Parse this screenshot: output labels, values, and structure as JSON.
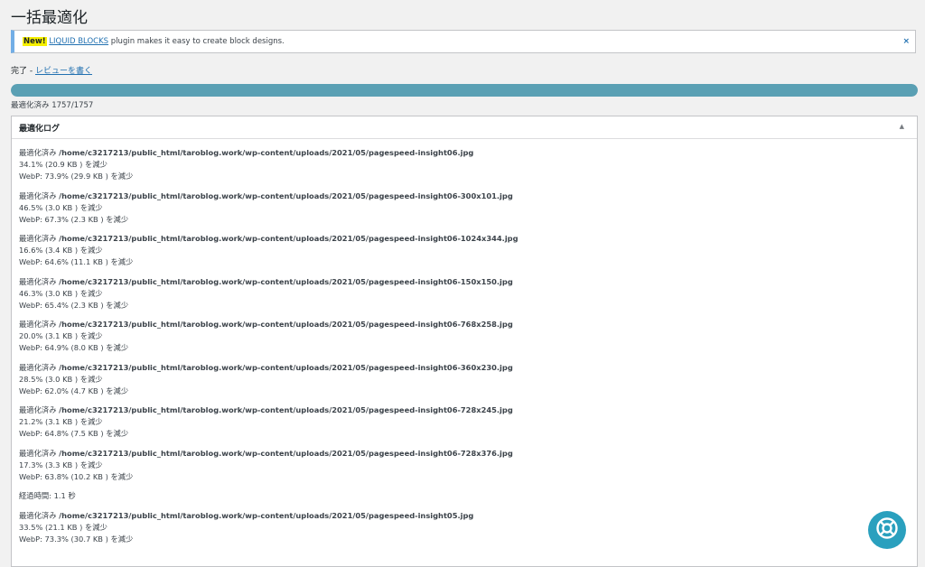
{
  "page": {
    "title": "一括最適化"
  },
  "notice": {
    "new_badge": "New!",
    "link_text": "LIQUID BLOCKS",
    "message": " plugin makes it easy to create block designs.",
    "dismiss": "×"
  },
  "status": {
    "done": "完了",
    "separator": " - ",
    "review_link": "レビューを書く"
  },
  "progress": {
    "value": 1.0,
    "label": "最適化済み 1757/1757"
  },
  "log": {
    "title": "最適化ログ",
    "toggle_icon": "▲",
    "prefix": "最適化済み ",
    "entries": [
      {
        "path": "/home/c3217213/public_html/taroblog.work/wp-content/uploads/2021/05/pagespeed-insight06.jpg",
        "saved": "34.1% (20.9 KB ) を減少",
        "webp": "WebP: 73.9% (29.9 KB ) を減少"
      },
      {
        "path": "/home/c3217213/public_html/taroblog.work/wp-content/uploads/2021/05/pagespeed-insight06-300x101.jpg",
        "saved": "46.5% (3.0 KB ) を減少",
        "webp": "WebP: 67.3% (2.3 KB ) を減少"
      },
      {
        "path": "/home/c3217213/public_html/taroblog.work/wp-content/uploads/2021/05/pagespeed-insight06-1024x344.jpg",
        "saved": "16.6% (3.4 KB ) を減少",
        "webp": "WebP: 64.6% (11.1 KB ) を減少"
      },
      {
        "path": "/home/c3217213/public_html/taroblog.work/wp-content/uploads/2021/05/pagespeed-insight06-150x150.jpg",
        "saved": "46.3% (3.0 KB ) を減少",
        "webp": "WebP: 65.4% (2.3 KB ) を減少"
      },
      {
        "path": "/home/c3217213/public_html/taroblog.work/wp-content/uploads/2021/05/pagespeed-insight06-768x258.jpg",
        "saved": "20.0% (3.1 KB ) を減少",
        "webp": "WebP: 64.9% (8.0 KB ) を減少"
      },
      {
        "path": "/home/c3217213/public_html/taroblog.work/wp-content/uploads/2021/05/pagespeed-insight06-360x230.jpg",
        "saved": "28.5% (3.0 KB ) を減少",
        "webp": "WebP: 62.0% (4.7 KB ) を減少"
      },
      {
        "path": "/home/c3217213/public_html/taroblog.work/wp-content/uploads/2021/05/pagespeed-insight06-728x245.jpg",
        "saved": "21.2% (3.1 KB ) を減少",
        "webp": "WebP: 64.8% (7.5 KB ) を減少"
      },
      {
        "path": "/home/c3217213/public_html/taroblog.work/wp-content/uploads/2021/05/pagespeed-insight06-728x376.jpg",
        "saved": "17.3% (3.3 KB ) を減少",
        "webp": "WebP: 63.8% (10.2 KB ) を減少"
      }
    ],
    "elapsed": "経過時間: 1.1 秒",
    "last_entry": {
      "path": "/home/c3217213/public_html/taroblog.work/wp-content/uploads/2021/05/pagespeed-insight05.jpg",
      "saved": "33.5% (21.1 KB ) を減少",
      "webp": "WebP: 73.3% (30.7 KB ) を減少"
    }
  },
  "help_button": {
    "icon": "lifebuoy-icon"
  },
  "colors": {
    "accent": "#5aa0b4",
    "link": "#2271b1",
    "help": "#2aa0be",
    "badge": "#f6f000"
  }
}
